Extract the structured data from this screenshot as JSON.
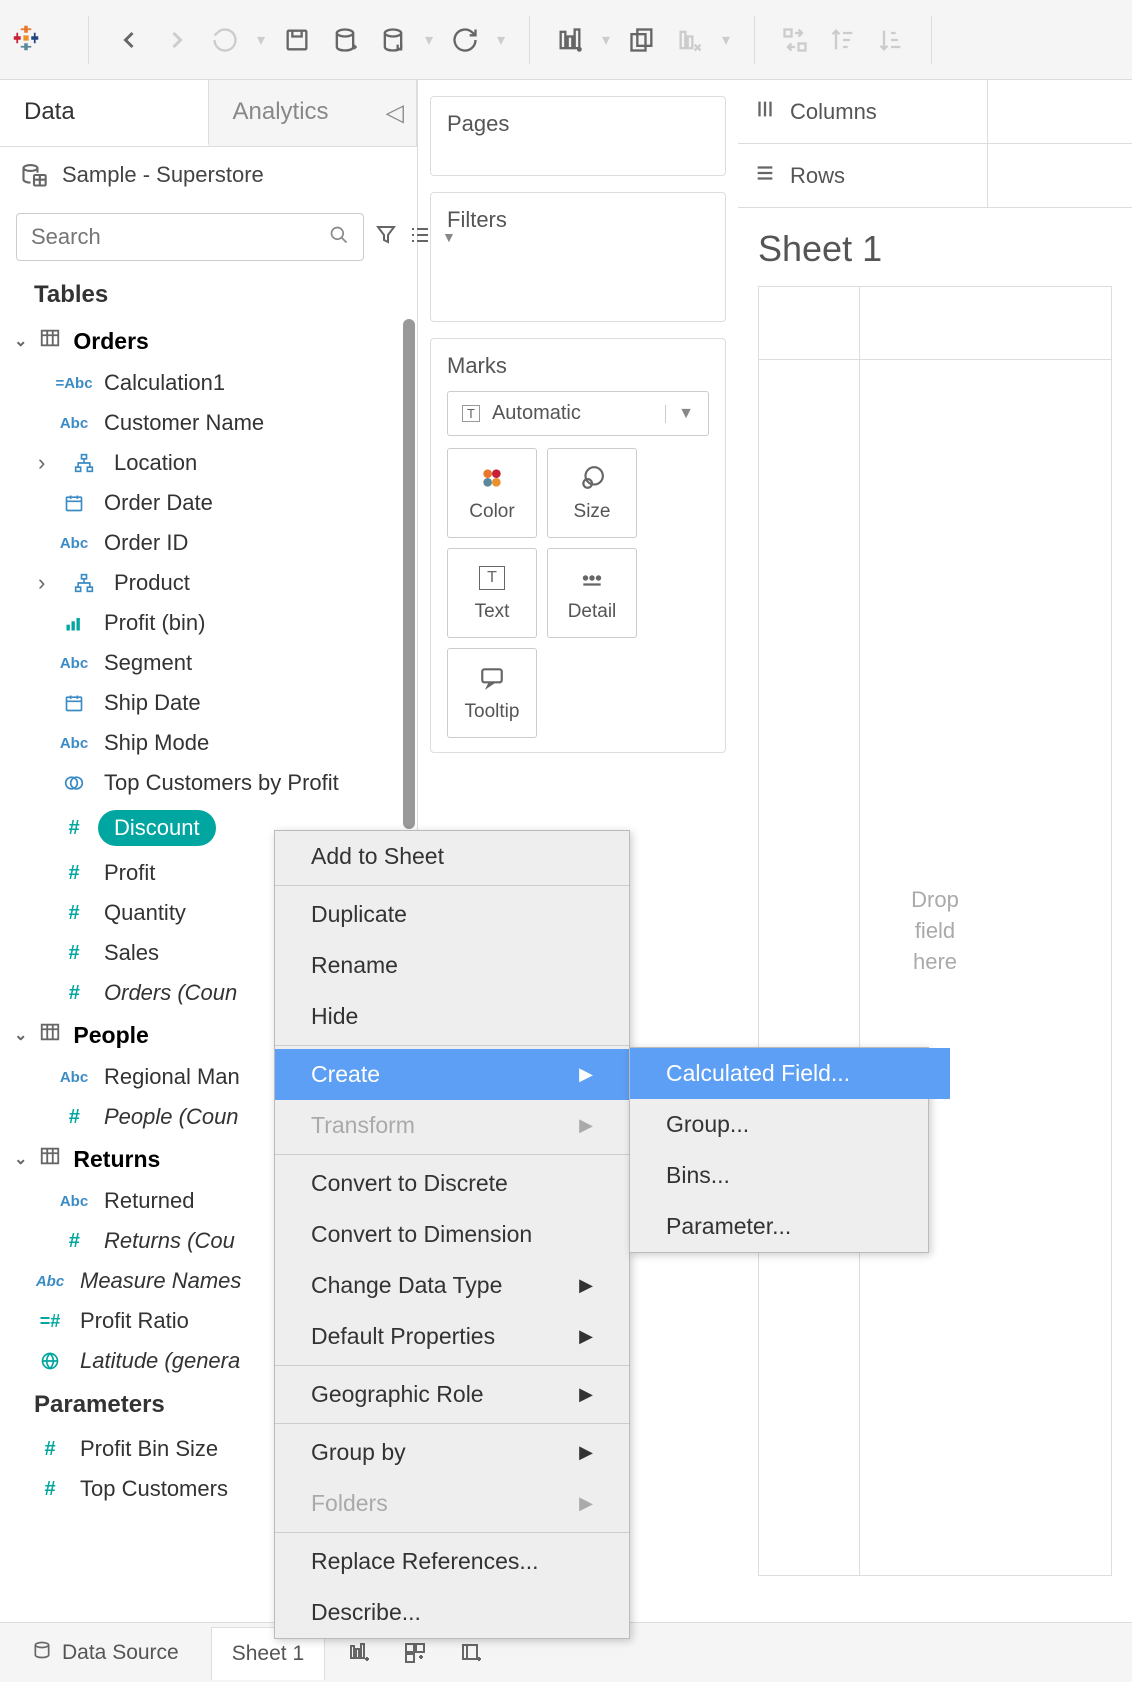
{
  "toolbar": {},
  "sidebar": {
    "tabs": {
      "data": "Data",
      "analytics": "Analytics"
    },
    "datasource": "Sample - Superstore",
    "search_placeholder": "Search",
    "tables_header": "Tables",
    "parameters_header": "Parameters",
    "tables": [
      {
        "name": "Orders",
        "fields": [
          {
            "label": "Calculation1",
            "type": "calc-abc"
          },
          {
            "label": "Customer Name",
            "type": "abc"
          },
          {
            "label": "Location",
            "type": "hier",
            "expandable": true
          },
          {
            "label": "Order Date",
            "type": "date"
          },
          {
            "label": "Order ID",
            "type": "abc"
          },
          {
            "label": "Product",
            "type": "hier",
            "expandable": true
          },
          {
            "label": "Profit (bin)",
            "type": "bin"
          },
          {
            "label": "Segment",
            "type": "abc"
          },
          {
            "label": "Ship Date",
            "type": "date"
          },
          {
            "label": "Ship Mode",
            "type": "abc"
          },
          {
            "label": "Top Customers by Profit",
            "type": "set"
          },
          {
            "label": "Discount",
            "type": "hash",
            "selected": true
          },
          {
            "label": "Profit",
            "type": "hash"
          },
          {
            "label": "Quantity",
            "type": "hash"
          },
          {
            "label": "Sales",
            "type": "hash"
          },
          {
            "label": "Orders (Coun",
            "type": "hash",
            "italic": true
          }
        ]
      },
      {
        "name": "People",
        "fields": [
          {
            "label": "Regional Man",
            "type": "abc"
          },
          {
            "label": "People (Coun",
            "type": "hash",
            "italic": true
          }
        ]
      },
      {
        "name": "Returns",
        "fields": [
          {
            "label": "Returned",
            "type": "abc"
          },
          {
            "label": "Returns (Cou",
            "type": "hash",
            "italic": true
          }
        ]
      }
    ],
    "global_fields": [
      {
        "label": "Measure Names",
        "type": "abc",
        "italic": true
      },
      {
        "label": "Profit Ratio",
        "type": "calc-hash"
      },
      {
        "label": "Latitude (genera",
        "type": "globe",
        "italic": true
      }
    ],
    "parameters": [
      {
        "label": "Profit Bin Size",
        "type": "hash"
      },
      {
        "label": "Top Customers",
        "type": "hash"
      }
    ]
  },
  "shelves": {
    "pages": "Pages",
    "filters": "Filters",
    "marks": "Marks",
    "marks_type": "Automatic",
    "mark_cards": [
      {
        "label": "Color",
        "icon": "color"
      },
      {
        "label": "Size",
        "icon": "size"
      },
      {
        "label": "Text",
        "icon": "text"
      },
      {
        "label": "Detail",
        "icon": "detail"
      },
      {
        "label": "Tooltip",
        "icon": "tooltip"
      }
    ]
  },
  "canvas": {
    "columns": "Columns",
    "rows": "Rows",
    "sheet_title": "Sheet 1",
    "drop_hint": "Drop\nfield\nhere"
  },
  "bottom": {
    "data_source": "Data Source",
    "sheet": "Sheet 1"
  },
  "context_menu": {
    "items": [
      {
        "label": "Add to Sheet"
      },
      {
        "divider": true
      },
      {
        "label": "Duplicate"
      },
      {
        "label": "Rename"
      },
      {
        "label": "Hide"
      },
      {
        "divider": true
      },
      {
        "label": "Create",
        "submenu": true,
        "highlighted": true
      },
      {
        "label": "Transform",
        "submenu": true,
        "disabled": true
      },
      {
        "divider": true
      },
      {
        "label": "Convert to Discrete"
      },
      {
        "label": "Convert to Dimension"
      },
      {
        "label": "Change Data Type",
        "submenu": true
      },
      {
        "label": "Default Properties",
        "submenu": true
      },
      {
        "divider": true
      },
      {
        "label": "Geographic Role",
        "submenu": true
      },
      {
        "divider": true
      },
      {
        "label": "Group by",
        "submenu": true
      },
      {
        "label": "Folders",
        "submenu": true,
        "disabled": true
      },
      {
        "divider": true
      },
      {
        "label": "Replace References..."
      },
      {
        "label": "Describe..."
      }
    ],
    "submenu_create": [
      {
        "label": "Calculated Field...",
        "highlighted": true
      },
      {
        "label": "Group..."
      },
      {
        "label": "Bins..."
      },
      {
        "label": "Parameter..."
      }
    ]
  }
}
